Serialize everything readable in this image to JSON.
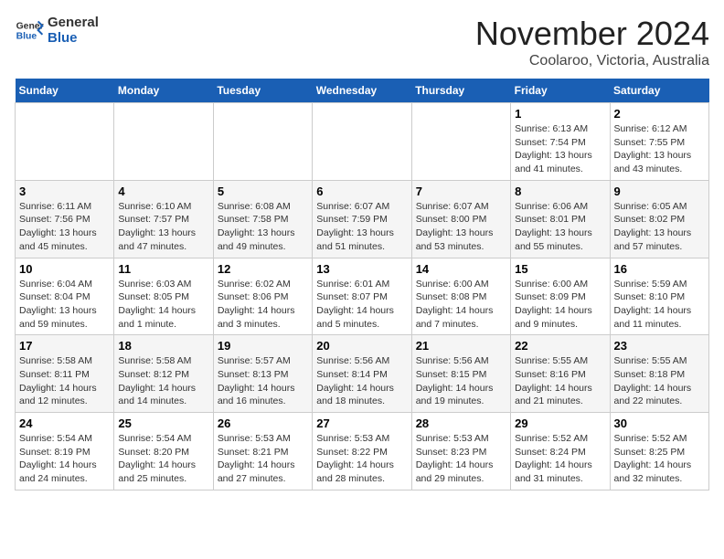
{
  "logo": {
    "line1": "General",
    "line2": "Blue"
  },
  "title": "November 2024",
  "location": "Coolaroo, Victoria, Australia",
  "days_of_week": [
    "Sunday",
    "Monday",
    "Tuesday",
    "Wednesday",
    "Thursday",
    "Friday",
    "Saturday"
  ],
  "weeks": [
    [
      {
        "day": "",
        "info": ""
      },
      {
        "day": "",
        "info": ""
      },
      {
        "day": "",
        "info": ""
      },
      {
        "day": "",
        "info": ""
      },
      {
        "day": "",
        "info": ""
      },
      {
        "day": "1",
        "info": "Sunrise: 6:13 AM\nSunset: 7:54 PM\nDaylight: 13 hours\nand 41 minutes."
      },
      {
        "day": "2",
        "info": "Sunrise: 6:12 AM\nSunset: 7:55 PM\nDaylight: 13 hours\nand 43 minutes."
      }
    ],
    [
      {
        "day": "3",
        "info": "Sunrise: 6:11 AM\nSunset: 7:56 PM\nDaylight: 13 hours\nand 45 minutes."
      },
      {
        "day": "4",
        "info": "Sunrise: 6:10 AM\nSunset: 7:57 PM\nDaylight: 13 hours\nand 47 minutes."
      },
      {
        "day": "5",
        "info": "Sunrise: 6:08 AM\nSunset: 7:58 PM\nDaylight: 13 hours\nand 49 minutes."
      },
      {
        "day": "6",
        "info": "Sunrise: 6:07 AM\nSunset: 7:59 PM\nDaylight: 13 hours\nand 51 minutes."
      },
      {
        "day": "7",
        "info": "Sunrise: 6:07 AM\nSunset: 8:00 PM\nDaylight: 13 hours\nand 53 minutes."
      },
      {
        "day": "8",
        "info": "Sunrise: 6:06 AM\nSunset: 8:01 PM\nDaylight: 13 hours\nand 55 minutes."
      },
      {
        "day": "9",
        "info": "Sunrise: 6:05 AM\nSunset: 8:02 PM\nDaylight: 13 hours\nand 57 minutes."
      }
    ],
    [
      {
        "day": "10",
        "info": "Sunrise: 6:04 AM\nSunset: 8:04 PM\nDaylight: 13 hours\nand 59 minutes."
      },
      {
        "day": "11",
        "info": "Sunrise: 6:03 AM\nSunset: 8:05 PM\nDaylight: 14 hours\nand 1 minute."
      },
      {
        "day": "12",
        "info": "Sunrise: 6:02 AM\nSunset: 8:06 PM\nDaylight: 14 hours\nand 3 minutes."
      },
      {
        "day": "13",
        "info": "Sunrise: 6:01 AM\nSunset: 8:07 PM\nDaylight: 14 hours\nand 5 minutes."
      },
      {
        "day": "14",
        "info": "Sunrise: 6:00 AM\nSunset: 8:08 PM\nDaylight: 14 hours\nand 7 minutes."
      },
      {
        "day": "15",
        "info": "Sunrise: 6:00 AM\nSunset: 8:09 PM\nDaylight: 14 hours\nand 9 minutes."
      },
      {
        "day": "16",
        "info": "Sunrise: 5:59 AM\nSunset: 8:10 PM\nDaylight: 14 hours\nand 11 minutes."
      }
    ],
    [
      {
        "day": "17",
        "info": "Sunrise: 5:58 AM\nSunset: 8:11 PM\nDaylight: 14 hours\nand 12 minutes."
      },
      {
        "day": "18",
        "info": "Sunrise: 5:58 AM\nSunset: 8:12 PM\nDaylight: 14 hours\nand 14 minutes."
      },
      {
        "day": "19",
        "info": "Sunrise: 5:57 AM\nSunset: 8:13 PM\nDaylight: 14 hours\nand 16 minutes."
      },
      {
        "day": "20",
        "info": "Sunrise: 5:56 AM\nSunset: 8:14 PM\nDaylight: 14 hours\nand 18 minutes."
      },
      {
        "day": "21",
        "info": "Sunrise: 5:56 AM\nSunset: 8:15 PM\nDaylight: 14 hours\nand 19 minutes."
      },
      {
        "day": "22",
        "info": "Sunrise: 5:55 AM\nSunset: 8:16 PM\nDaylight: 14 hours\nand 21 minutes."
      },
      {
        "day": "23",
        "info": "Sunrise: 5:55 AM\nSunset: 8:18 PM\nDaylight: 14 hours\nand 22 minutes."
      }
    ],
    [
      {
        "day": "24",
        "info": "Sunrise: 5:54 AM\nSunset: 8:19 PM\nDaylight: 14 hours\nand 24 minutes."
      },
      {
        "day": "25",
        "info": "Sunrise: 5:54 AM\nSunset: 8:20 PM\nDaylight: 14 hours\nand 25 minutes."
      },
      {
        "day": "26",
        "info": "Sunrise: 5:53 AM\nSunset: 8:21 PM\nDaylight: 14 hours\nand 27 minutes."
      },
      {
        "day": "27",
        "info": "Sunrise: 5:53 AM\nSunset: 8:22 PM\nDaylight: 14 hours\nand 28 minutes."
      },
      {
        "day": "28",
        "info": "Sunrise: 5:53 AM\nSunset: 8:23 PM\nDaylight: 14 hours\nand 29 minutes."
      },
      {
        "day": "29",
        "info": "Sunrise: 5:52 AM\nSunset: 8:24 PM\nDaylight: 14 hours\nand 31 minutes."
      },
      {
        "day": "30",
        "info": "Sunrise: 5:52 AM\nSunset: 8:25 PM\nDaylight: 14 hours\nand 32 minutes."
      }
    ]
  ]
}
